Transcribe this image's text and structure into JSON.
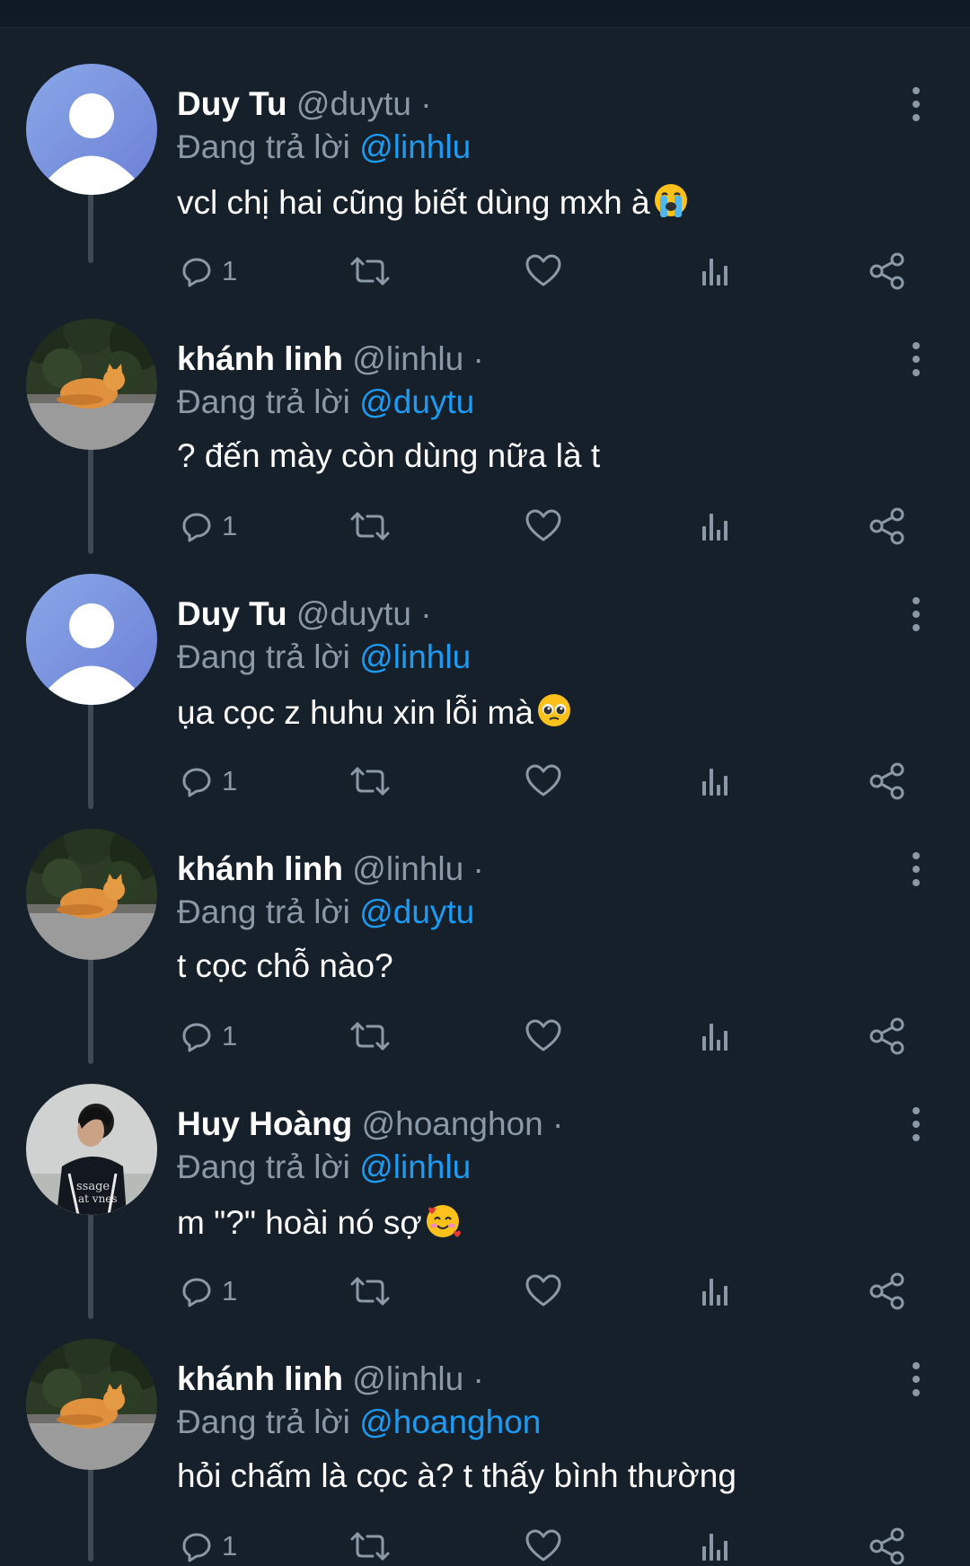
{
  "labels": {
    "replying_to": "Đang trả lời"
  },
  "colors": {
    "background": "#15202b",
    "secondary_text": "#8b98a5",
    "mention": "#1d9bf0",
    "thread_line": "#3d4a56"
  },
  "tweets": [
    {
      "name": "Duy Tu",
      "handle": "@duytu",
      "separator": "·",
      "reply_to": "@linhlu",
      "text": "vcl chị hai cũng biết dùng mxh à",
      "emoji": "loudly-crying-face",
      "reply_count": "1",
      "avatar": "default-user"
    },
    {
      "name": "khánh linh",
      "handle": "@linhlu",
      "separator": "·",
      "reply_to": "@duytu",
      "text": "? đến mày còn dùng nữa là t",
      "emoji": "",
      "reply_count": "1",
      "avatar": "cat-photo"
    },
    {
      "name": "Duy Tu",
      "handle": "@duytu",
      "separator": "·",
      "reply_to": "@linhlu",
      "text": "ụa cọc z huhu xin lỗi mà",
      "emoji": "pleading-face",
      "reply_count": "1",
      "avatar": "default-user"
    },
    {
      "name": "khánh linh",
      "handle": "@linhlu",
      "separator": "·",
      "reply_to": "@duytu",
      "text": "t cọc chỗ nào?",
      "emoji": "",
      "reply_count": "1",
      "avatar": "cat-photo"
    },
    {
      "name": "Huy Hoàng",
      "handle": "@hoanghon",
      "separator": "·",
      "reply_to": "@linhlu",
      "text": "m \"?\" hoài nó sợ",
      "emoji": "smiling-face-with-hearts",
      "reply_count": "1",
      "avatar": "person-photo"
    },
    {
      "name": "khánh linh",
      "handle": "@linhlu",
      "separator": "·",
      "reply_to": "@hoanghon",
      "text": "hỏi chấm là cọc à? t thấy bình thường",
      "emoji": "",
      "reply_count": "1",
      "avatar": "cat-photo"
    }
  ]
}
